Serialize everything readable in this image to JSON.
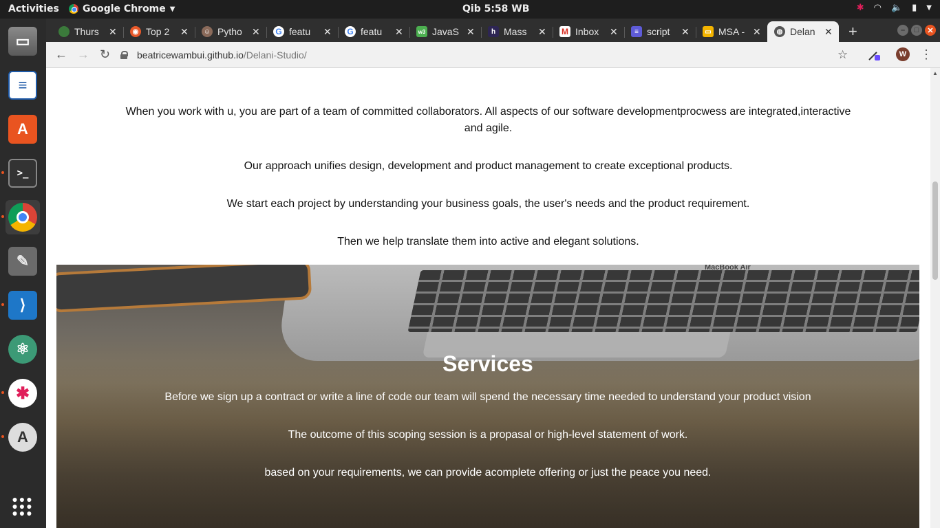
{
  "system": {
    "activities": "Activities",
    "app_name": "Google Chrome",
    "clock": "Qib  5:58 WB"
  },
  "tabs": [
    {
      "title": "Thurs",
      "favicon": "green-circle",
      "color": "#3b7a3b"
    },
    {
      "title": "Top 2",
      "favicon": "orange-circle",
      "color": "#e8592a"
    },
    {
      "title": "Pytho",
      "favicon": "avatar",
      "color": "#8a6a5a"
    },
    {
      "title": "featu",
      "favicon": "google-g",
      "color": "#4285f4"
    },
    {
      "title": "featu",
      "favicon": "google-g",
      "color": "#4285f4"
    },
    {
      "title": "JavaS",
      "favicon": "w3-green",
      "color": "#4caf50"
    },
    {
      "title": "Mass",
      "favicon": "h-dark",
      "color": "#2d2553"
    },
    {
      "title": "Inbox",
      "favicon": "gmail-m",
      "color": "#d93025"
    },
    {
      "title": "script",
      "favicon": "docs-blue",
      "color": "#5e5bd7"
    },
    {
      "title": "MSA -",
      "favicon": "slides-yellow",
      "color": "#f4b400"
    },
    {
      "title": "Delan",
      "favicon": "globe",
      "color": "#555555",
      "active": true
    }
  ],
  "address": {
    "host": "beatricewambui.github.io",
    "path": "/Delani-Studio/"
  },
  "profile_initial": "W",
  "about": {
    "p1_line1": "When you work with u, you are part of a team of committed collaborators. All aspects of our software developmentprocwess are integrated,interactive",
    "p1_line2": "and agile.",
    "p2": "Our approach unifies design, development and product management to create exceptional products.",
    "p3": "We start each project by understanding your business goals, the user's needs and the product requirement.",
    "p4": "Then we help translate them into active and elegant solutions."
  },
  "services": {
    "heading": "Services",
    "p1": "Before we sign up a contract or write a line of code our team will spend the necessary time needed to understand your product vision",
    "p2": "The outcome of this scoping session is a propasal or high-level statement of work.",
    "p3": "based on your requirements, we can provide acomplete offering or just the peace you need.",
    "image_brand_text": "MacBook Air"
  }
}
